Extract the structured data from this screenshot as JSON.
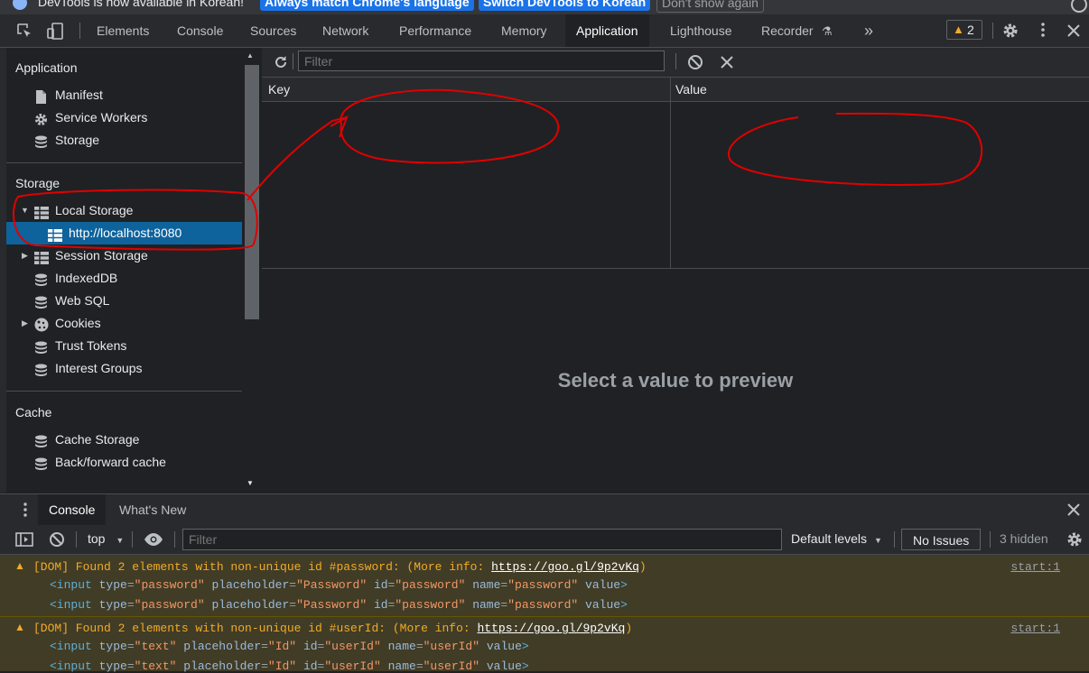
{
  "infobar": {
    "text": "DevTools is now available in Korean!",
    "btn_match": "Always match Chrome's language",
    "btn_switch": "Switch DevTools to Korean",
    "btn_dismiss": "Don't show again"
  },
  "tabs": {
    "elements": "Elements",
    "console": "Console",
    "sources": "Sources",
    "network": "Network",
    "performance": "Performance",
    "memory": "Memory",
    "application": "Application",
    "lighthouse": "Lighthouse",
    "recorder": "Recorder",
    "more": "»",
    "warnings_count": "2"
  },
  "sidebar": {
    "application_title": "Application",
    "manifest": "Manifest",
    "service_workers": "Service Workers",
    "storage_item": "Storage",
    "storage_title": "Storage",
    "local_storage": "Local Storage",
    "localhost": "http://localhost:8080",
    "session_storage": "Session Storage",
    "indexeddb": "IndexedDB",
    "websql": "Web SQL",
    "cookies": "Cookies",
    "trust_tokens": "Trust Tokens",
    "interest_groups": "Interest Groups",
    "cache_title": "Cache",
    "cache_storage": "Cache Storage",
    "bf_cache": "Back/forward cache"
  },
  "main": {
    "filter_placeholder": "Filter",
    "col_key": "Key",
    "col_value": "Value",
    "preview_text": "Select a value to preview"
  },
  "drawer": {
    "tab_console": "Console",
    "tab_whats_new": "What's New",
    "context": "top",
    "filter_placeholder": "Filter",
    "levels": "Default levels",
    "no_issues": "No Issues",
    "hidden": "3 hidden"
  },
  "messages": [
    {
      "text": "[DOM] Found 2 elements with non-unique id #password: (More info: ",
      "link": "https://goo.gl/9p2vKq",
      "close": ")",
      "source": "start:1"
    },
    {
      "text": "[DOM] Found 2 elements with non-unique id #userId: (More info: ",
      "link": "https://goo.gl/9p2vKq",
      "close": ")",
      "source": "start:1"
    }
  ],
  "colors": {
    "accent": "#0e639c",
    "warning_bg": "#413c26",
    "warning_text": "#f2ab26",
    "annotation": "#e00000"
  }
}
